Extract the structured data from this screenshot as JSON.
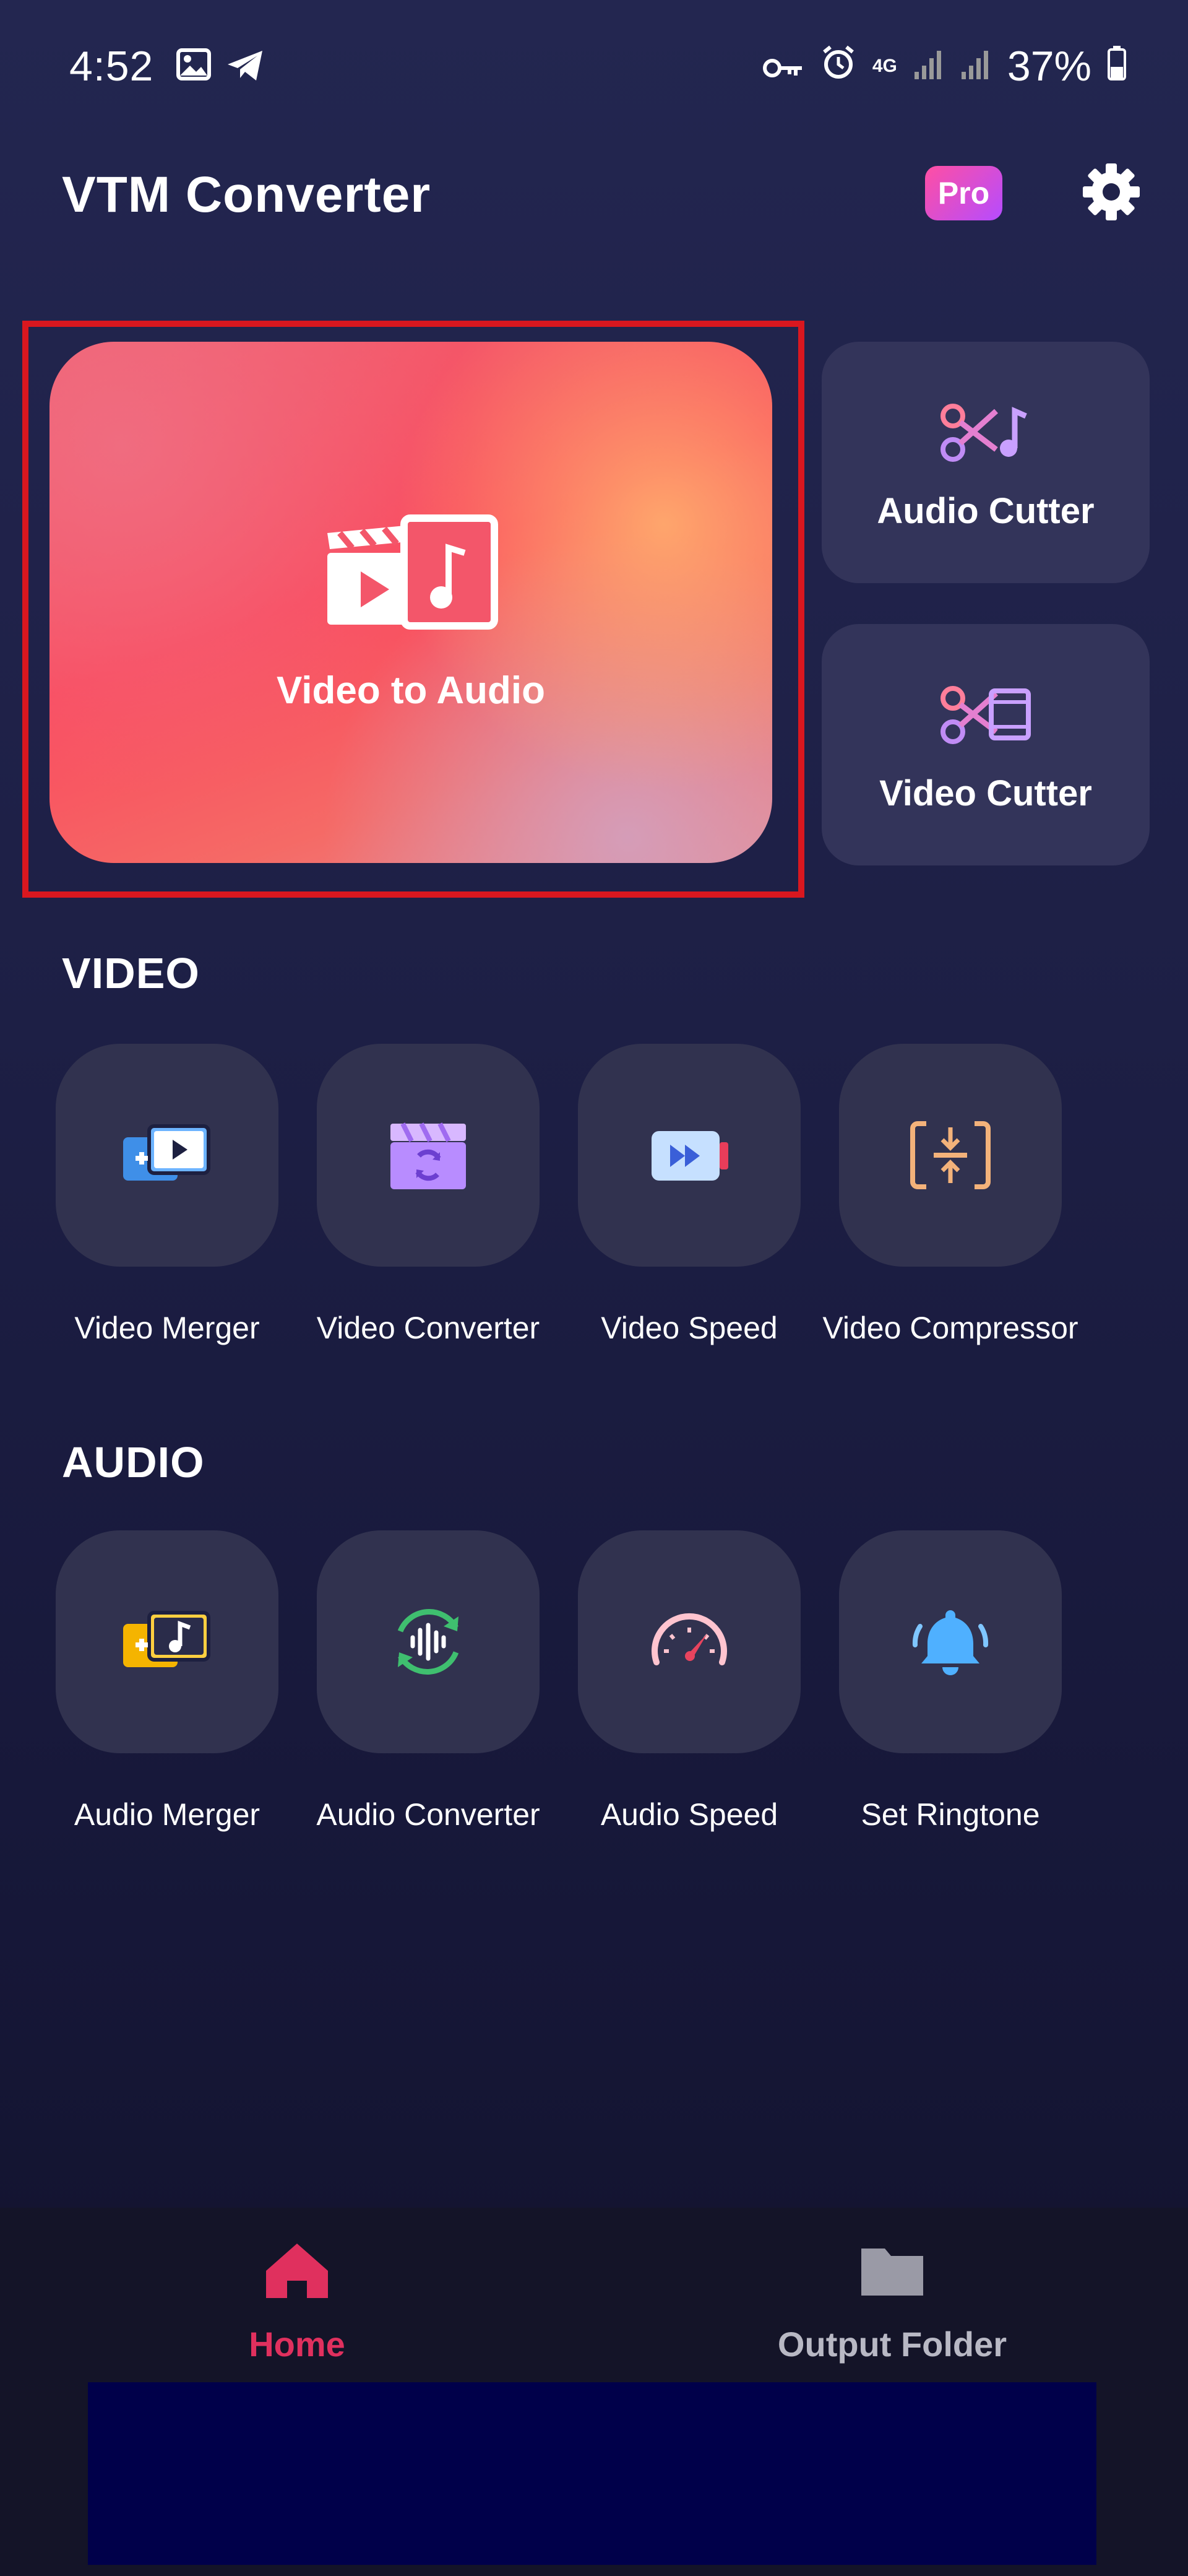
{
  "status_bar": {
    "time": "4:52",
    "network": "4G",
    "battery": "37%"
  },
  "app_bar": {
    "title": "VTM Converter",
    "pro_label": "Pro",
    "settings_icon": "gear-icon"
  },
  "featured": {
    "main": {
      "label": "Video to Audio",
      "icon": "video-to-audio-icon",
      "selected": true
    },
    "side": [
      {
        "label": "Audio Cutter",
        "icon": "scissors-music-icon"
      },
      {
        "label": "Video Cutter",
        "icon": "scissors-film-icon"
      }
    ]
  },
  "video_section": {
    "title": "VIDEO",
    "items": [
      {
        "label": "Video Merger",
        "icon": "video-merge-icon"
      },
      {
        "label": "Video Converter",
        "icon": "video-convert-icon"
      },
      {
        "label": "Video Speed",
        "icon": "video-speed-icon"
      },
      {
        "label": "Video Compressor",
        "icon": "compress-icon"
      }
    ]
  },
  "audio_section": {
    "title": "AUDIO",
    "items": [
      {
        "label": "Audio Merger",
        "icon": "audio-merge-icon"
      },
      {
        "label": "Audio Converter",
        "icon": "audio-convert-icon"
      },
      {
        "label": "Audio Speed",
        "icon": "speedometer-icon"
      },
      {
        "label": "Set Ringtone",
        "icon": "bell-icon"
      }
    ]
  },
  "bottom_nav": {
    "items": [
      {
        "label": "Home",
        "icon": "home-icon",
        "active": true
      },
      {
        "label": "Output Folder",
        "icon": "folder-icon",
        "active": false
      }
    ]
  },
  "colors": {
    "accent_pink": "#e0305e",
    "highlight_red": "#d9171f",
    "tile_bg": "#31324f"
  }
}
